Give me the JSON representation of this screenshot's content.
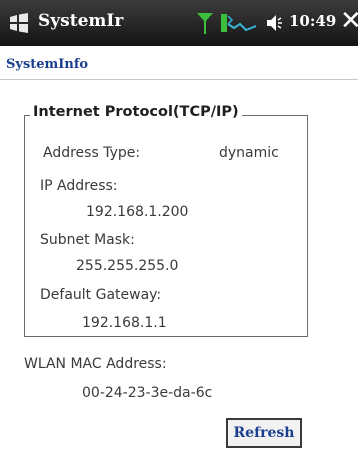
{
  "titlebar": {
    "title": "SystemIr",
    "time": "10:49",
    "close_glyph": "✕",
    "icons": [
      "windows-logo-icon",
      "signal-strength-icon",
      "network-activity-icon",
      "volume-icon",
      "close-icon"
    ]
  },
  "app": {
    "title": "SystemInfo"
  },
  "tcpip": {
    "legend": "Internet Protocol(TCP/IP)",
    "address_type_label": "Address Type:",
    "address_type_value": "dynamic",
    "ip_label": "IP Address:",
    "ip_value": "192.168.1.200",
    "subnet_label": "Subnet Mask:",
    "subnet_value": "255.255.255.0",
    "gateway_label": "Default Gateway:",
    "gateway_value": "192.168.1.1"
  },
  "wlan": {
    "mac_label": "WLAN MAC Address:",
    "mac_value": "00-24-23-3e-da-6c"
  },
  "actions": {
    "refresh_label": "Refresh"
  },
  "colors": {
    "titlebar_bg": "#1e1e1e",
    "app_title": "#1b3f8f",
    "signal_green": "#3cbf3c",
    "network_cyan": "#37b6d8"
  }
}
